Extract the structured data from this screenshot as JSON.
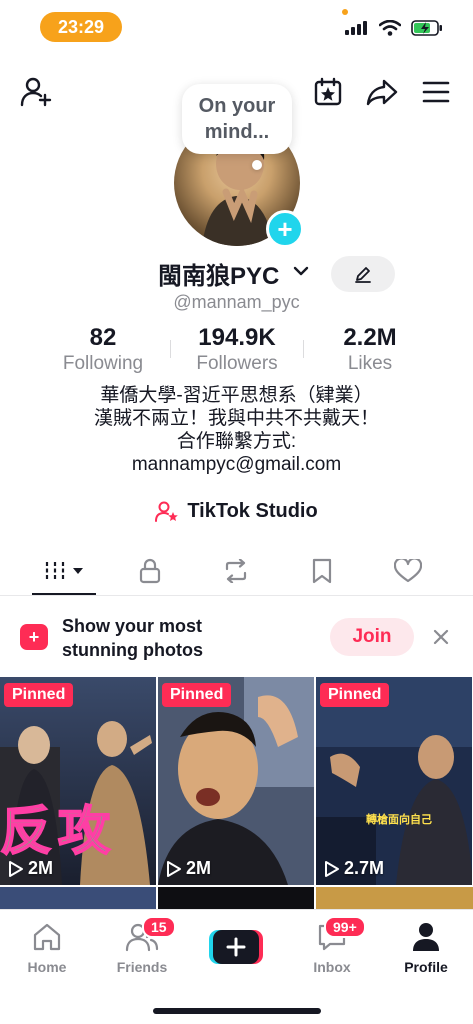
{
  "status_bar": {
    "time": "23:29"
  },
  "profile": {
    "bubble_text": "On your mind...",
    "name": "閩南狼PYC",
    "handle": "@mannam_pyc"
  },
  "stats": [
    {
      "value": "82",
      "label": "Following"
    },
    {
      "value": "194.9K",
      "label": "Followers"
    },
    {
      "value": "2.2M",
      "label": "Likes"
    }
  ],
  "bio": {
    "line1": "華僑大學-習近平思想系（肄業）",
    "line2": "漢賊不兩立！我與中共不共戴天！",
    "line3": "合作聯繫方式:",
    "line4": "mannampyc@gmail.com"
  },
  "studio": {
    "label": "TikTok Studio"
  },
  "promo": {
    "line1": "Show your most",
    "line2": "stunning photos",
    "join_label": "Join"
  },
  "videos": [
    {
      "badge": "Pinned",
      "views": "2M",
      "overlay_text": "反攻"
    },
    {
      "badge": "Pinned",
      "views": "2M",
      "overlay_text": ""
    },
    {
      "badge": "Pinned",
      "views": "2.7M",
      "overlay_text": "轉槍面向自己"
    }
  ],
  "bottom_nav": {
    "home": "Home",
    "friends": "Friends",
    "friends_badge": "15",
    "inbox": "Inbox",
    "inbox_badge": "99+",
    "profile": "Profile"
  },
  "colors": {
    "accent": "#fe2c55",
    "cyan": "#20d5ec",
    "time_pill": "#f7a21b"
  }
}
